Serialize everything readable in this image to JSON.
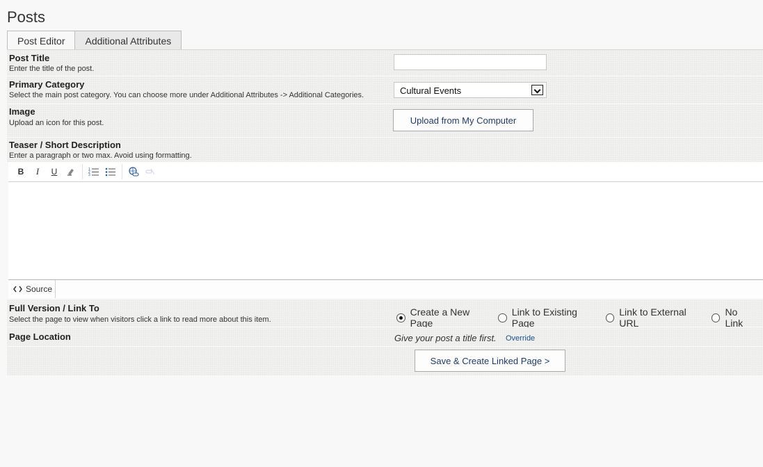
{
  "page": {
    "title": "Posts"
  },
  "tabs": [
    {
      "label": "Post Editor"
    },
    {
      "label": "Additional Attributes"
    }
  ],
  "fields": {
    "post_title": {
      "label": "Post Title",
      "hint": "Enter the title of the post.",
      "value": ""
    },
    "primary_category": {
      "label": "Primary Category",
      "hint": "Select the main post category. You can choose more under Additional Attributes -> Additional Categories.",
      "selected": "Cultural Events"
    },
    "image": {
      "label": "Image",
      "hint": "Upload an icon for this post.",
      "button": "Upload from My Computer"
    },
    "teaser": {
      "label": "Teaser / Short Description",
      "hint": "Enter a paragraph or two max. Avoid using formatting.",
      "toolbar": {
        "bold": "B",
        "italic": "I",
        "underline": "U",
        "icons": [
          "remove-format-icon",
          "numbered-list-icon",
          "bulleted-list-icon",
          "link-icon",
          "unlink-icon"
        ]
      },
      "source_label": "Source"
    },
    "full_version": {
      "label": "Full Version / Link To",
      "hint": "Select the page to view when visitors click a link to read more about this item.",
      "options": [
        "Create a New Page",
        "Link to Existing Page",
        "Link to External URL",
        "No Link"
      ],
      "selected": "Create a New Page"
    },
    "page_location": {
      "label": "Page Location",
      "note": "Give your post a title first.",
      "override": "Override"
    }
  },
  "actions": {
    "save": "Save & Create Linked Page >"
  }
}
